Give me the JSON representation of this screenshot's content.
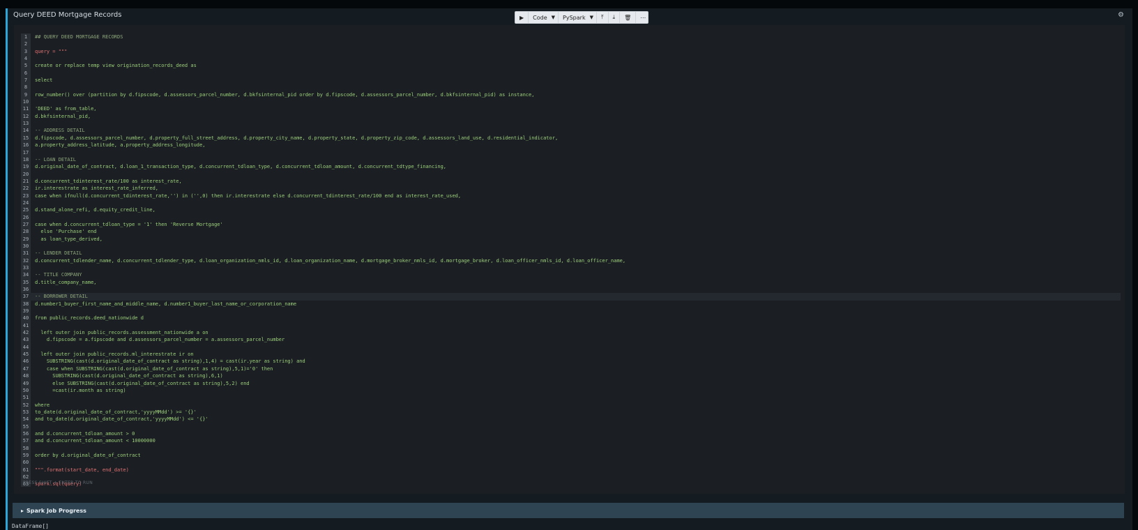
{
  "cell": {
    "title": "Query DEED Mortgage Records",
    "gear_icon": "⚙"
  },
  "toolbar": {
    "run_icon": "▶",
    "cell_type": "Code",
    "language": "PySpark",
    "move_up_icon": "⤒",
    "move_down_icon": "⤓",
    "delete_icon": "🗑",
    "more_icon": "⋯"
  },
  "editor": {
    "lines": [
      {
        "n": "1",
        "text": "## QUERY DEED MORTGAGE RECORDS",
        "cls": "comment"
      },
      {
        "n": "2",
        "text": "",
        "cls": ""
      },
      {
        "n": "3",
        "text": "query = \"\"\"",
        "cls": "kw"
      },
      {
        "n": "4",
        "text": "",
        "cls": ""
      },
      {
        "n": "5",
        "text": "create or replace temp view origination_records_deed as",
        "cls": ""
      },
      {
        "n": "6",
        "text": "",
        "cls": ""
      },
      {
        "n": "7",
        "text": "select",
        "cls": ""
      },
      {
        "n": "8",
        "text": "",
        "cls": ""
      },
      {
        "n": "9",
        "text": "row_number() over (partition by d.fipscode, d.assessors_parcel_number, d.bkfsinternal_pid order by d.fipscode, d.assessors_parcel_number, d.bkfsinternal_pid) as instance,",
        "cls": ""
      },
      {
        "n": "10",
        "text": "",
        "cls": ""
      },
      {
        "n": "11",
        "text": "'DEED' as from_table,",
        "cls": ""
      },
      {
        "n": "12",
        "text": "d.bkfsinternal_pid,",
        "cls": ""
      },
      {
        "n": "13",
        "text": "",
        "cls": ""
      },
      {
        "n": "14",
        "text": "-- ADDRESS DETAIL",
        "cls": "comment"
      },
      {
        "n": "15",
        "text": "d.fipscode, d.assessors_parcel_number, d.property_full_street_address, d.property_city_name, d.property_state, d.property_zip_code, d.assessors_land_use, d.residential_indicator,",
        "cls": ""
      },
      {
        "n": "16",
        "text": "a.property_address_latitude, a.property_address_longitude,",
        "cls": ""
      },
      {
        "n": "17",
        "text": "",
        "cls": ""
      },
      {
        "n": "18",
        "text": "-- LOAN DETAIL",
        "cls": "comment"
      },
      {
        "n": "19",
        "text": "d.original_date_of_contract, d.loan_1_transaction_type, d.concurrent_tdloan_type, d.concurrent_tdloan_amount, d.concurrent_tdtype_financing,",
        "cls": ""
      },
      {
        "n": "20",
        "text": "",
        "cls": ""
      },
      {
        "n": "21",
        "text": "d.concurrent_tdinterest_rate/100 as interest_rate,",
        "cls": ""
      },
      {
        "n": "22",
        "text": "ir.interestrate as interest_rate_inferred,",
        "cls": ""
      },
      {
        "n": "23",
        "text": "case when ifnull(d.concurrent_tdinterest_rate,'') in ('',0) then ir.interestrate else d.concurrent_tdinterest_rate/100 end as interest_rate_used,",
        "cls": ""
      },
      {
        "n": "24",
        "text": "",
        "cls": ""
      },
      {
        "n": "25",
        "text": "d.stand_alone_refi, d.equity_credit_line,",
        "cls": ""
      },
      {
        "n": "26",
        "text": "",
        "cls": ""
      },
      {
        "n": "27",
        "text": "case when d.concurrent_tdloan_type = '1' then 'Reverse Mortgage'",
        "cls": ""
      },
      {
        "n": "28",
        "text": "  else 'Purchase' end",
        "cls": ""
      },
      {
        "n": "29",
        "text": "  as loan_type_derived,",
        "cls": ""
      },
      {
        "n": "30",
        "text": "",
        "cls": ""
      },
      {
        "n": "31",
        "text": "-- LENDER DETAIL",
        "cls": "comment"
      },
      {
        "n": "32",
        "text": "d.concurrent_tdlender_name, d.concurrent_tdlender_type, d.loan_organization_nmls_id, d.loan_organization_name, d.mortgage_broker_nmls_id, d.mortgage_broker, d.loan_officer_nmls_id, d.loan_officer_name,",
        "cls": ""
      },
      {
        "n": "33",
        "text": "",
        "cls": ""
      },
      {
        "n": "34",
        "text": "-- TITLE COMPANY",
        "cls": "comment"
      },
      {
        "n": "35",
        "text": "d.title_company_name,",
        "cls": ""
      },
      {
        "n": "36",
        "text": "",
        "cls": ""
      },
      {
        "n": "37",
        "text": "-- BORROWER DETAIL",
        "cls": "comment active"
      },
      {
        "n": "38",
        "text": "d.number1_buyer_first_name_and_middle_name, d.number1_buyer_last_name_or_corporation_name",
        "cls": ""
      },
      {
        "n": "39",
        "text": "",
        "cls": ""
      },
      {
        "n": "40",
        "text": "from public_records.deed_nationwide d",
        "cls": ""
      },
      {
        "n": "41",
        "text": "",
        "cls": ""
      },
      {
        "n": "42",
        "text": "  left outer join public_records.assessment_nationwide a on",
        "cls": ""
      },
      {
        "n": "43",
        "text": "    d.fipscode = a.fipscode and d.assessors_parcel_number = a.assessors_parcel_number",
        "cls": ""
      },
      {
        "n": "44",
        "text": "",
        "cls": ""
      },
      {
        "n": "45",
        "text": "  left outer join public_records.ml_interestrate ir on",
        "cls": ""
      },
      {
        "n": "46",
        "text": "    SUBSTRING(cast(d.original_date_of_contract as string),1,4) = cast(ir.year as string) and",
        "cls": ""
      },
      {
        "n": "47",
        "text": "    case when SUBSTRING(cast(d.original_date_of_contract as string),5,1)='0' then",
        "cls": ""
      },
      {
        "n": "48",
        "text": "      SUBSTRING(cast(d.original_date_of_contract as string),6,1)",
        "cls": ""
      },
      {
        "n": "49",
        "text": "      else SUBSTRING(cast(d.original_date_of_contract as string),5,2) end",
        "cls": ""
      },
      {
        "n": "50",
        "text": "      =cast(ir.month as string)",
        "cls": ""
      },
      {
        "n": "51",
        "text": "",
        "cls": ""
      },
      {
        "n": "52",
        "text": "where",
        "cls": ""
      },
      {
        "n": "53",
        "text": "to_date(d.original_date_of_contract,'yyyyMMdd') >= '{}'",
        "cls": ""
      },
      {
        "n": "54",
        "text": "and to_date(d.original_date_of_contract,'yyyyMMdd') <= '{}'",
        "cls": ""
      },
      {
        "n": "55",
        "text": "",
        "cls": ""
      },
      {
        "n": "56",
        "text": "and d.concurrent_tdloan_amount > 0",
        "cls": ""
      },
      {
        "n": "57",
        "text": "and d.concurrent_tdloan_amount < 10000000",
        "cls": ""
      },
      {
        "n": "58",
        "text": "",
        "cls": ""
      },
      {
        "n": "59",
        "text": "order by d.original_date_of_contract",
        "cls": ""
      },
      {
        "n": "60",
        "text": "",
        "cls": ""
      },
      {
        "n": "61",
        "text": "\"\"\".format(start_date, end_date)",
        "cls": "kw"
      },
      {
        "n": "62",
        "text": "",
        "cls": ""
      },
      {
        "n": "63",
        "text": "spark.sql(query)",
        "cls": "kw"
      }
    ],
    "hint": "PRESS SHIFT + ENTER TO RUN"
  },
  "spark_job": {
    "caret_icon": "▸",
    "label": "Spark Job Progress"
  },
  "output": {
    "text": "DataFrame[]"
  }
}
